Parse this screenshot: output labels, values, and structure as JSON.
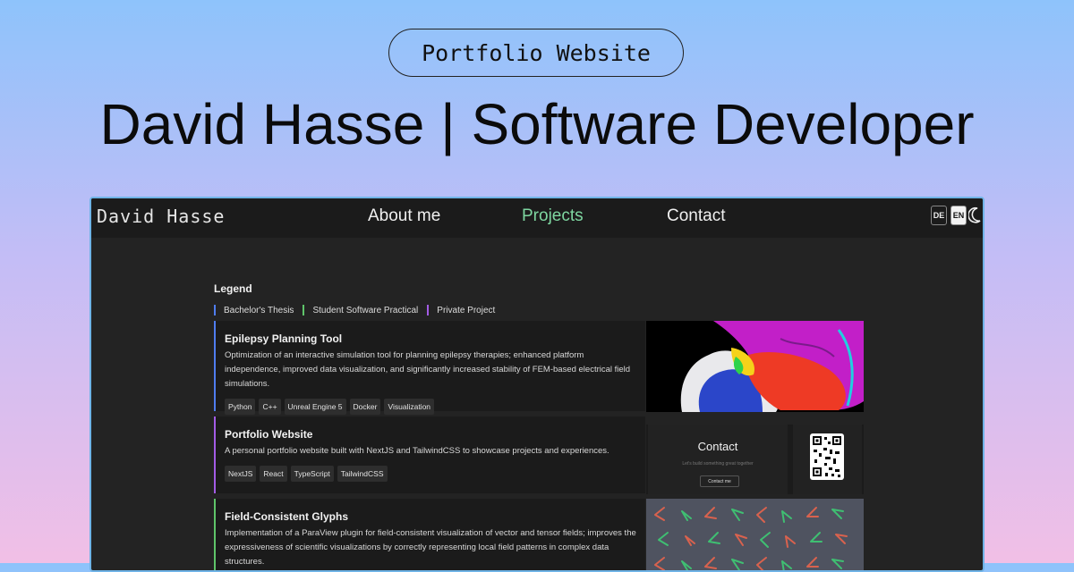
{
  "badge": "Portfolio Website",
  "headline": "David Hasse | Software Developer",
  "site": {
    "brand": "David Hasse",
    "nav": [
      "About me",
      "Projects",
      "Contact"
    ],
    "active_nav": "Projects",
    "lang_de": "DE",
    "lang_en": "EN"
  },
  "legend": {
    "title": "Legend",
    "items": [
      {
        "label": "Bachelor's Thesis",
        "color": "#4f7df0"
      },
      {
        "label": "Student Software Practical",
        "color": "#5fc56a"
      },
      {
        "label": "Private Project",
        "color": "#a35ce6"
      }
    ]
  },
  "projects": [
    {
      "title": "Epilepsy Planning Tool",
      "description": "Optimization of an interactive simulation tool for planning epilepsy therapies; enhanced platform independence, improved data visualization, and significantly increased stability of FEM-based electrical field simulations.",
      "tags": [
        "Python",
        "C++",
        "Unreal Engine 5",
        "Docker",
        "Visualization"
      ],
      "color": "#4f7df0"
    },
    {
      "title": "Portfolio Website",
      "description": "A personal portfolio website built with NextJS and TailwindCSS to showcase projects and experiences.",
      "tags": [
        "NextJS",
        "React",
        "TypeScript",
        "TailwindCSS"
      ],
      "color": "#a35ce6"
    },
    {
      "title": "Field-Consistent Glyphs",
      "description": "Implementation of a ParaView plugin for field-consistent visualization of vector and tensor fields; improves the expressiveness of scientific visualizations by correctly representing local field patterns in complex data structures.",
      "tags": [],
      "color": "#5fc56a"
    }
  ],
  "thumb_contact": {
    "title": "Contact",
    "subtitle": "Let's build something great together",
    "button": "Contact me"
  }
}
